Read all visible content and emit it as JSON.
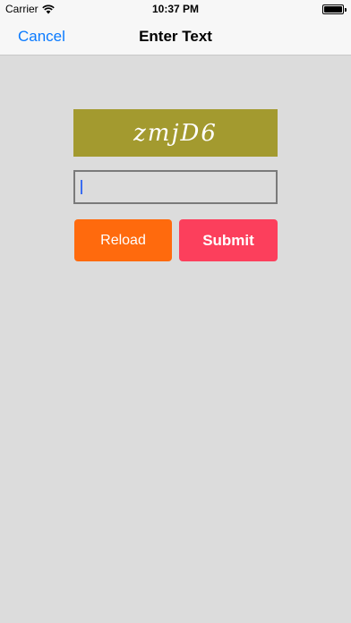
{
  "status_bar": {
    "carrier": "Carrier",
    "time": "10:37 PM",
    "wifi_icon": "wifi-icon",
    "battery_icon": "battery-icon"
  },
  "nav": {
    "cancel_label": "Cancel",
    "title": "Enter Text"
  },
  "captcha": {
    "text": "zmjD6",
    "background_color": "#a39a2f"
  },
  "input": {
    "value": "",
    "placeholder": ""
  },
  "buttons": {
    "reload_label": "Reload",
    "reload_color": "#ff6a0d",
    "submit_label": "Submit",
    "submit_color": "#fc3f5c"
  },
  "colors": {
    "accent": "#0a7aff",
    "background": "#dcdcdc"
  }
}
